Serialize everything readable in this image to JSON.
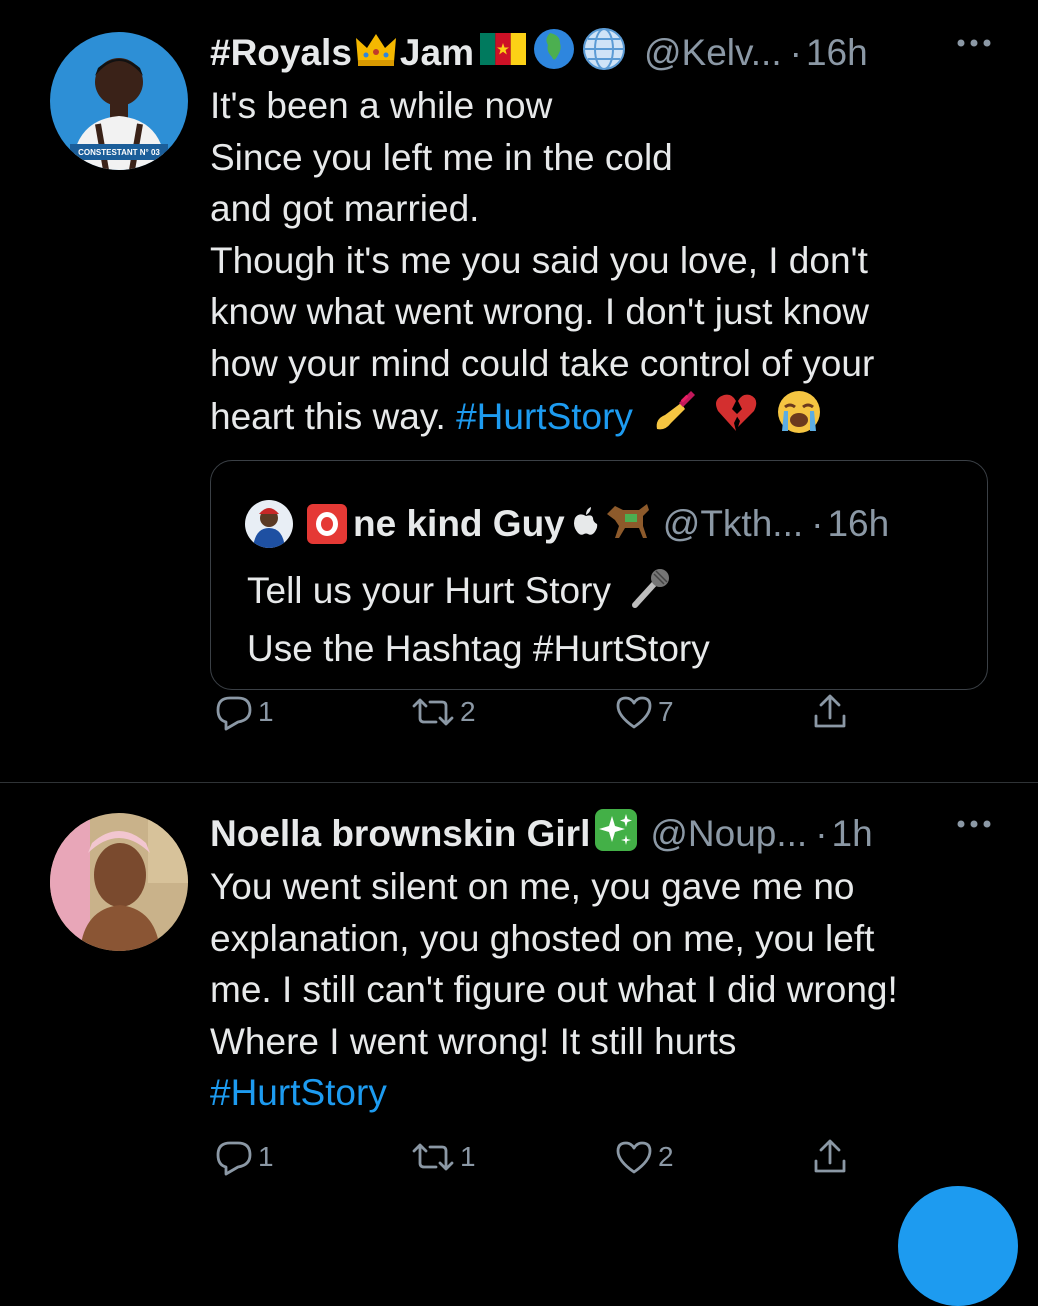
{
  "colors": {
    "background": "#000000",
    "text": "#e7e9ea",
    "muted": "#8b98a5",
    "link": "#1d9bf0",
    "divider": "#2f3336"
  },
  "tweets": [
    {
      "display_name": "#Royals",
      "name_suffix": "Jam",
      "name_emojis": [
        "crown-icon",
        "cameroon-flag-icon",
        "globe-africa-icon",
        "globe-meridians-icon"
      ],
      "handle": "@Kelv...",
      "dot": "·",
      "time": "16h",
      "text_lines": [
        "It's been a while now",
        "Since you left me in the cold",
        "and got married.",
        "Though it's me you said you love, I don't",
        "know what went wrong. I don't just know",
        "how your mind could take control of your"
      ],
      "last_line_text": "heart this way.",
      "hashtag": "#HurtStory",
      "trailing_emojis": [
        "nail-polish-icon",
        "broken-heart-icon",
        "crying-face-icon"
      ],
      "avatar_caption": "CONSTESTANT N° 03",
      "quote": {
        "display_name_letter": "O",
        "display_name": "ne kind Guy",
        "name_emojis": [
          "apple-icon",
          "horse-icon"
        ],
        "handle": "@Tkth...",
        "dot": "·",
        "time": "16h",
        "line1": "Tell us your Hurt Story",
        "line2": "Use the Hashtag #HurtStory"
      },
      "actions": {
        "replies": "1",
        "retweets": "2",
        "likes": "7"
      }
    },
    {
      "display_name": "Noella brownskin Girl",
      "name_emojis": [
        "sparkles-icon"
      ],
      "handle": "@Noup...",
      "dot": "·",
      "time": "1h",
      "text_lines": [
        "You went silent on me, you gave me no",
        "explanation, you ghosted on me, you left",
        "me. I still can't figure out what I did wrong!",
        "Where I went wrong! It still hurts"
      ],
      "hashtag": "#HurtStory",
      "actions": {
        "replies": "1",
        "retweets": "1",
        "likes": "2"
      }
    }
  ]
}
